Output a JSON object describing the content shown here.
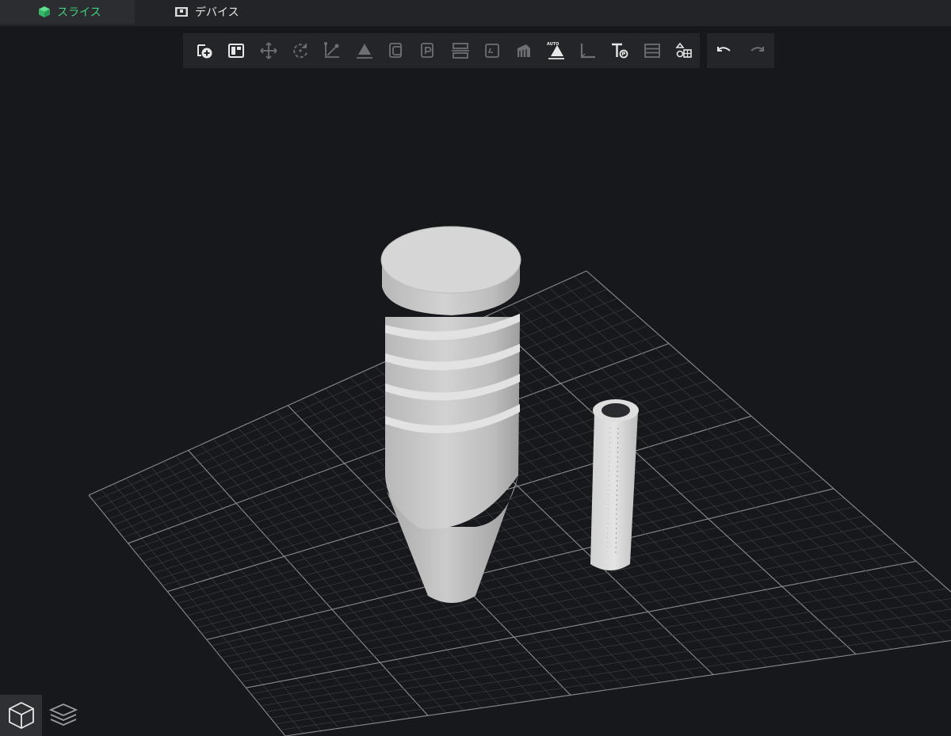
{
  "tabs": [
    {
      "label": "スライス",
      "icon": "cube-icon",
      "active": true
    },
    {
      "label": "デバイス",
      "icon": "printer-icon",
      "active": false
    }
  ],
  "toolbar": {
    "tools": [
      {
        "name": "add-model",
        "icon": "add-model-icon",
        "enabled": true
      },
      {
        "name": "arrange",
        "icon": "arrange-icon",
        "enabled": true
      },
      {
        "name": "move",
        "icon": "move-icon",
        "enabled": false
      },
      {
        "name": "rotate",
        "icon": "rotate-icon",
        "enabled": false
      },
      {
        "name": "scale",
        "icon": "scale-icon",
        "enabled": false
      },
      {
        "name": "lay-flat",
        "icon": "lay-flat-icon",
        "enabled": false
      },
      {
        "name": "hollow",
        "icon": "hollow-icon",
        "enabled": false
      },
      {
        "name": "punch-hole",
        "icon": "punch-hole-icon",
        "enabled": false
      },
      {
        "name": "split",
        "icon": "split-icon",
        "enabled": false
      },
      {
        "name": "base",
        "icon": "base-icon",
        "enabled": false
      },
      {
        "name": "support",
        "icon": "support-icon",
        "enabled": false
      },
      {
        "name": "auto-support",
        "icon": "auto-support-icon",
        "enabled": true,
        "badge": "AUTO"
      },
      {
        "name": "measure",
        "icon": "ruler-icon",
        "enabled": false
      },
      {
        "name": "text",
        "icon": "text-icon",
        "enabled": true
      },
      {
        "name": "layers",
        "icon": "layers-list-icon",
        "enabled": false
      },
      {
        "name": "shapes",
        "icon": "shapes-icon",
        "enabled": true
      }
    ],
    "history": [
      {
        "name": "undo",
        "icon": "undo-icon",
        "enabled": true
      },
      {
        "name": "redo",
        "icon": "redo-icon",
        "enabled": false
      }
    ]
  },
  "view_modes": [
    {
      "name": "3d-view",
      "icon": "cube-outline-icon",
      "active": true
    },
    {
      "name": "layer-view",
      "icon": "stacked-layers-icon",
      "active": false
    }
  ],
  "colors": {
    "accent": "#3fd07a",
    "background": "#17181b",
    "panel": "#242528",
    "icon_enabled": "#e8e8e8",
    "icon_disabled": "#6e6f73",
    "model": "#cfcfcf",
    "grid_major": "#8a8c90",
    "grid_minor": "#3a3c40"
  }
}
